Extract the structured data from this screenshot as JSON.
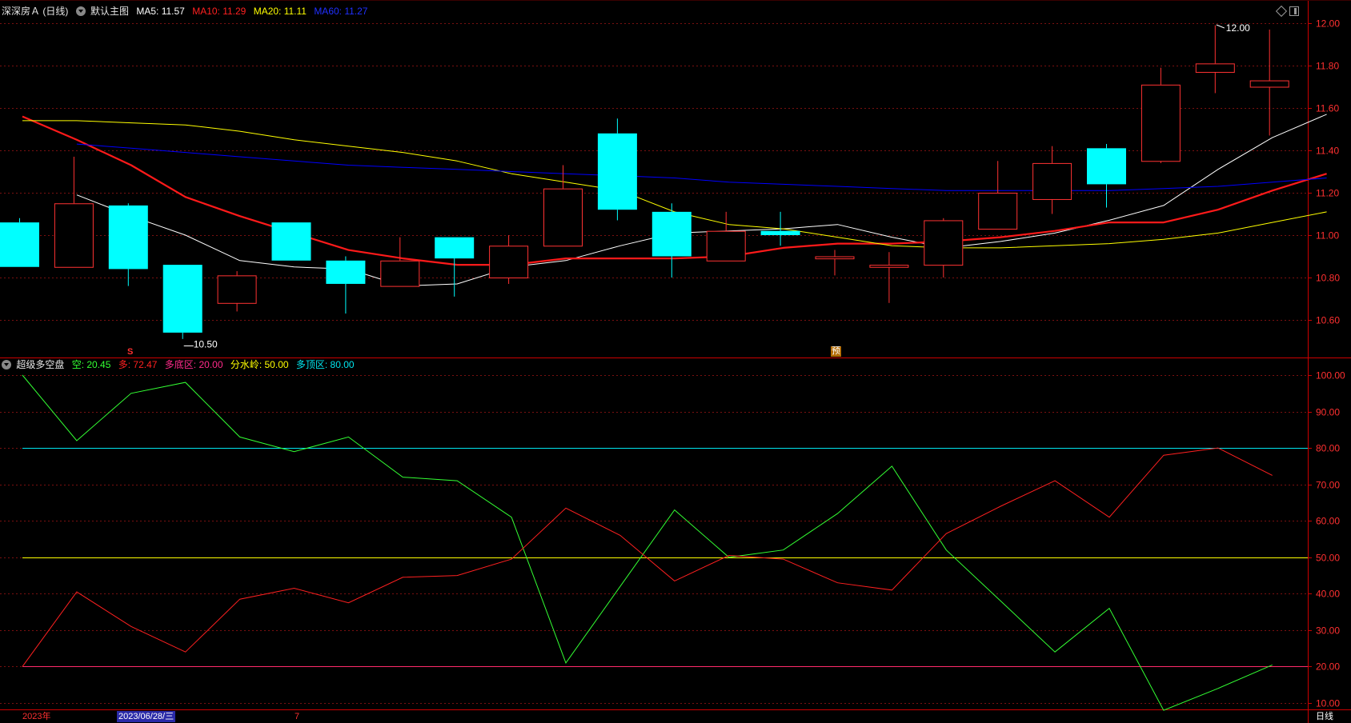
{
  "main_header": {
    "stock_title": "深深房Ａ (日线)",
    "template_label": "默认主图",
    "ma5_label": "MA5: 11.57",
    "ma10_label": "MA10: 11.29",
    "ma20_label": "MA20: 11.11",
    "ma60_label": "MA60: 11.27"
  },
  "sub_header": {
    "indicator_name": "超级多空盘",
    "kong_label": "空: 20.45",
    "duo_label": "多: 72.47",
    "bottom_zone_label": "多底区: 20.00",
    "watershed_label": "分水岭: 50.00",
    "top_zone_label": "多顶区: 80.00"
  },
  "footer": {
    "year_label": "2023年",
    "cursor_date": "2023/06/28/三",
    "month_label": "7",
    "period_button": "日线"
  },
  "markers": {
    "s_marker": "S",
    "yu_marker": "预"
  },
  "colors": {
    "up": "#ff3232",
    "down": "#00ffff",
    "ma5": "#ffffff",
    "ma10": "#ff1a1a",
    "ma20": "#ffff00",
    "ma60": "#0000ff",
    "kong": "#33ff33",
    "duo": "#ff2020",
    "grid": "#7a1010",
    "axis": "#cc0000"
  },
  "chart_data": [
    {
      "type": "candlestick",
      "title": "深深房Ａ (日线)",
      "ylim": [
        10.45,
        12.05
      ],
      "y_ticks": [
        "12.00",
        "11.80",
        "11.60",
        "11.40",
        "11.20",
        "11.00",
        "10.80",
        "10.60"
      ],
      "candles": [
        {
          "o": 11.06,
          "h": 11.08,
          "l": 10.85,
          "c": 10.85
        },
        {
          "o": 10.85,
          "h": 11.37,
          "l": 10.85,
          "c": 11.15
        },
        {
          "o": 11.14,
          "h": 11.15,
          "l": 10.76,
          "c": 10.84
        },
        {
          "o": 10.86,
          "h": 10.86,
          "l": 10.51,
          "c": 10.54
        },
        {
          "o": 10.68,
          "h": 10.83,
          "l": 10.64,
          "c": 10.81
        },
        {
          "o": 11.06,
          "h": 11.06,
          "l": 10.88,
          "c": 10.88
        },
        {
          "o": 10.88,
          "h": 10.9,
          "l": 10.63,
          "c": 10.77
        },
        {
          "o": 10.76,
          "h": 10.99,
          "l": 10.76,
          "c": 10.88
        },
        {
          "o": 10.99,
          "h": 10.99,
          "l": 10.71,
          "c": 10.89
        },
        {
          "o": 10.8,
          "h": 11.0,
          "l": 10.77,
          "c": 10.95
        },
        {
          "o": 10.95,
          "h": 11.33,
          "l": 10.95,
          "c": 11.22
        },
        {
          "o": 11.48,
          "h": 11.55,
          "l": 11.07,
          "c": 11.12
        },
        {
          "o": 11.11,
          "h": 11.15,
          "l": 10.8,
          "c": 10.9
        },
        {
          "o": 10.88,
          "h": 11.11,
          "l": 10.88,
          "c": 11.02
        },
        {
          "o": 11.02,
          "h": 11.11,
          "l": 10.95,
          "c": 11.0
        },
        {
          "o": 10.89,
          "h": 10.93,
          "l": 10.81,
          "c": 10.9
        },
        {
          "o": 10.85,
          "h": 10.92,
          "l": 10.68,
          "c": 10.86
        },
        {
          "o": 10.86,
          "h": 11.08,
          "l": 10.8,
          "c": 11.07
        },
        {
          "o": 11.03,
          "h": 11.35,
          "l": 11.03,
          "c": 11.2
        },
        {
          "o": 11.17,
          "h": 11.42,
          "l": 11.1,
          "c": 11.34
        },
        {
          "o": 11.41,
          "h": 11.43,
          "l": 11.13,
          "c": 11.24
        },
        {
          "o": 11.35,
          "h": 11.79,
          "l": 11.34,
          "c": 11.71
        },
        {
          "o": 11.77,
          "h": 11.99,
          "l": 11.67,
          "c": 11.81
        },
        {
          "o": 11.7,
          "h": 11.97,
          "l": 11.47,
          "c": 11.73
        }
      ],
      "series": [
        {
          "name": "MA5",
          "values": [
            11.19,
            11.09,
            11.0,
            10.88,
            10.85,
            10.84,
            10.76,
            10.77,
            10.85,
            10.88,
            10.95,
            11.01,
            11.02,
            11.03,
            11.05,
            10.99,
            10.94,
            10.97,
            11.01,
            11.07,
            11.14,
            11.31,
            11.46,
            11.57
          ]
        },
        {
          "name": "MA10",
          "values": [
            11.56,
            11.45,
            11.33,
            11.18,
            11.09,
            11.01,
            10.93,
            10.89,
            10.86,
            10.86,
            10.89,
            10.89,
            10.89,
            10.9,
            10.94,
            10.96,
            10.96,
            10.97,
            10.99,
            11.02,
            11.06,
            11.06,
            11.12,
            11.21,
            11.29
          ]
        },
        {
          "name": "MA20",
          "values": [
            11.54,
            11.54,
            11.53,
            11.52,
            11.49,
            11.45,
            11.42,
            11.39,
            11.35,
            11.29,
            11.25,
            11.21,
            11.11,
            11.05,
            11.03,
            10.99,
            10.95,
            10.94,
            10.94,
            10.95,
            10.96,
            10.98,
            11.01,
            11.06,
            11.11
          ]
        },
        {
          "name": "MA60",
          "values": [
            11.43,
            11.41,
            11.39,
            11.37,
            11.35,
            11.33,
            11.32,
            11.31,
            11.3,
            11.29,
            11.28,
            11.27,
            11.25,
            11.24,
            11.23,
            11.22,
            11.21,
            11.21,
            11.21,
            11.21,
            11.22,
            11.23,
            11.25,
            11.27
          ]
        }
      ],
      "annotations": [
        {
          "text": "12.00",
          "x_index": 22,
          "y": 12.0
        },
        {
          "text": "10.50",
          "x_index": 3,
          "y": 10.5
        }
      ]
    },
    {
      "type": "line",
      "title": "超级多空盘",
      "ylim": [
        5,
        103
      ],
      "y_ticks": [
        "100.00",
        "90.00",
        "80.00",
        "70.00",
        "60.00",
        "50.00",
        "40.00",
        "30.00",
        "20.00",
        "10.00"
      ],
      "series": [
        {
          "name": "空",
          "values": [
            100,
            82,
            95,
            98,
            83,
            79,
            83,
            72,
            71,
            61,
            21,
            42,
            63,
            50,
            52,
            62,
            75,
            52,
            38,
            24,
            36,
            8,
            14,
            20.45
          ]
        },
        {
          "name": "多",
          "values": [
            20,
            40.5,
            31,
            24,
            38.5,
            41.5,
            37.5,
            44.5,
            45,
            49.5,
            63.5,
            56,
            43.5,
            50.5,
            49.5,
            43,
            41,
            56.5,
            64,
            71,
            61,
            78,
            80,
            72.47
          ]
        }
      ],
      "reference_lines": [
        {
          "name": "多顶区",
          "value": 80
        },
        {
          "name": "分水岭",
          "value": 50
        },
        {
          "name": "多底区",
          "value": 20
        }
      ]
    }
  ]
}
